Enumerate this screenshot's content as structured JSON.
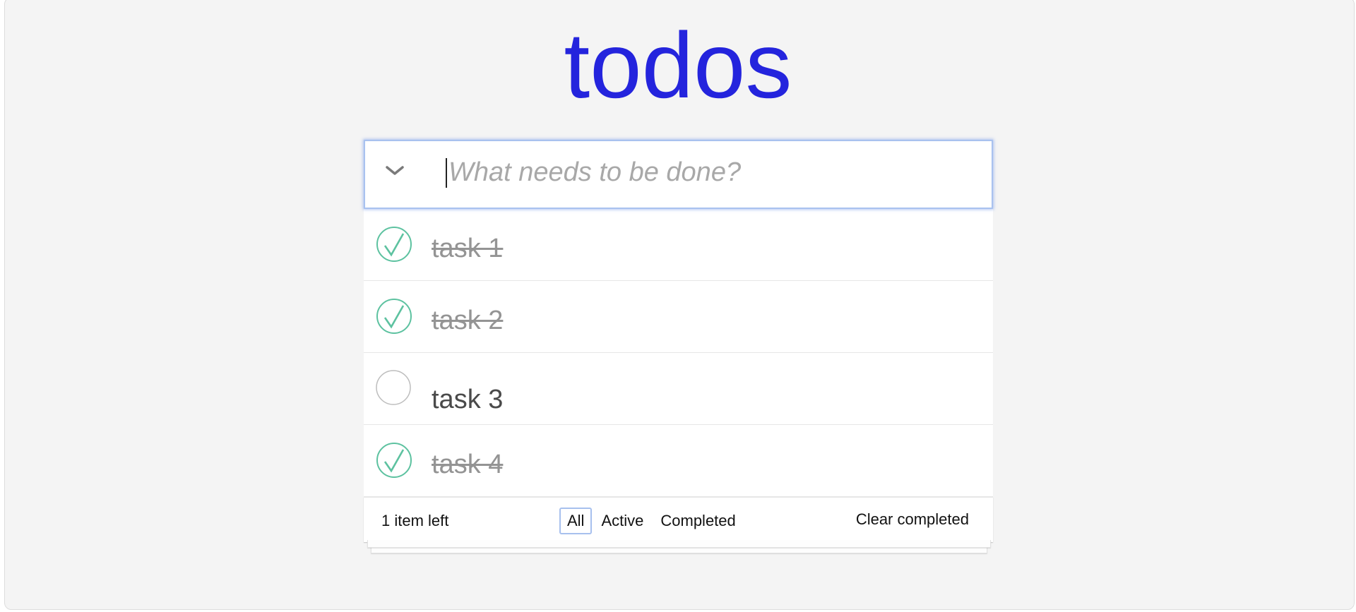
{
  "app": {
    "title": "todos",
    "accent_color": "#2424dd"
  },
  "header": {
    "toggle_icon": "chevron-down-icon",
    "new_todo_placeholder": "What needs to be done?",
    "new_todo_value": ""
  },
  "todos": [
    {
      "label": "task 1",
      "completed": true
    },
    {
      "label": "task 2",
      "completed": true
    },
    {
      "label": "task 3",
      "completed": false
    },
    {
      "label": "task 4",
      "completed": true
    }
  ],
  "footer": {
    "count_text": "1 item left",
    "filters": [
      {
        "label": "All",
        "selected": true
      },
      {
        "label": "Active",
        "selected": false
      },
      {
        "label": "Completed",
        "selected": false
      }
    ],
    "clear_label": "Clear completed"
  },
  "colors": {
    "check_complete": "#5dc2a0",
    "check_empty": "#bdbdbd",
    "completed_text": "#949494"
  }
}
